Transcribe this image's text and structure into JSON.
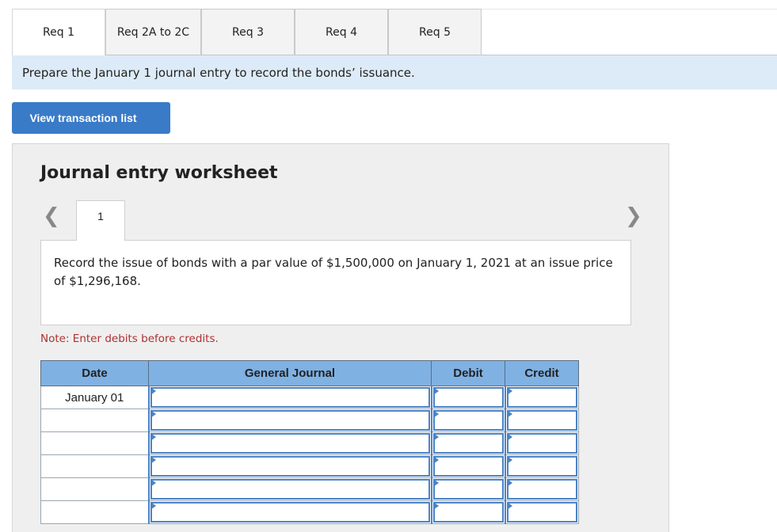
{
  "tabs": [
    {
      "label": "Req 1",
      "active": true
    },
    {
      "label": "Req 2A to 2C",
      "active": false
    },
    {
      "label": "Req 3",
      "active": false
    },
    {
      "label": "Req 4",
      "active": false
    },
    {
      "label": "Req 5",
      "active": false
    }
  ],
  "instruction": "Prepare the January 1 journal entry to record the bonds’ issuance.",
  "view_button": "View transaction list",
  "worksheet": {
    "title": "Journal entry worksheet",
    "nav_prev_icon": "chevron-left-icon",
    "nav_next_icon": "chevron-right-icon",
    "entry_tab": "1",
    "description": "Record the issue of bonds with a par value of $1,500,000 on January 1, 2021 at an issue price of $1,296,168.",
    "note": "Note: Enter debits before credits.",
    "table": {
      "headers": {
        "date": "Date",
        "journal": "General Journal",
        "debit": "Debit",
        "credit": "Credit"
      },
      "rows": [
        {
          "date": "January 01",
          "journal": "",
          "debit": "",
          "credit": ""
        },
        {
          "date": "",
          "journal": "",
          "debit": "",
          "credit": ""
        },
        {
          "date": "",
          "journal": "",
          "debit": "",
          "credit": ""
        },
        {
          "date": "",
          "journal": "",
          "debit": "",
          "credit": ""
        },
        {
          "date": "",
          "journal": "",
          "debit": "",
          "credit": ""
        },
        {
          "date": "",
          "journal": "",
          "debit": "",
          "credit": ""
        }
      ]
    }
  },
  "colors": {
    "accent_button": "#3a7bc8",
    "instruction_bg": "#dcebf7",
    "table_header_bg": "#7fb1e3",
    "note_text": "#b03030"
  }
}
